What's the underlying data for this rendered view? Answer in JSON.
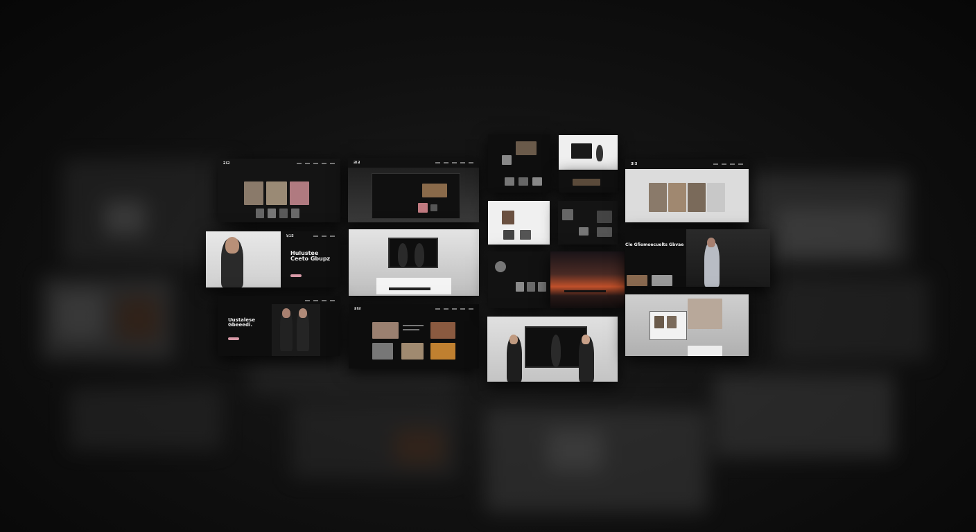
{
  "screens": {
    "s1": {
      "logo": "ƎƖƎ"
    },
    "s2": {
      "logo": "ƎlƎ"
    },
    "s3": {
      "logo": "ꓤ1Ƨ",
      "headline": "Hulustee Ceeto Gbupz"
    },
    "s5": {
      "headline": "Uustalese Gbeeedi."
    },
    "s6": {
      "logo": "ƎƖƎ"
    },
    "s9": {
      "headline": "Cle Gfiomoecuelts Gbvae"
    },
    "s12": {
      "logo": "ƎƖƎ"
    }
  },
  "colors": {
    "background": "#0d0d0d",
    "accent_pink": "#d89aa7",
    "sunset": "#c0502a"
  }
}
